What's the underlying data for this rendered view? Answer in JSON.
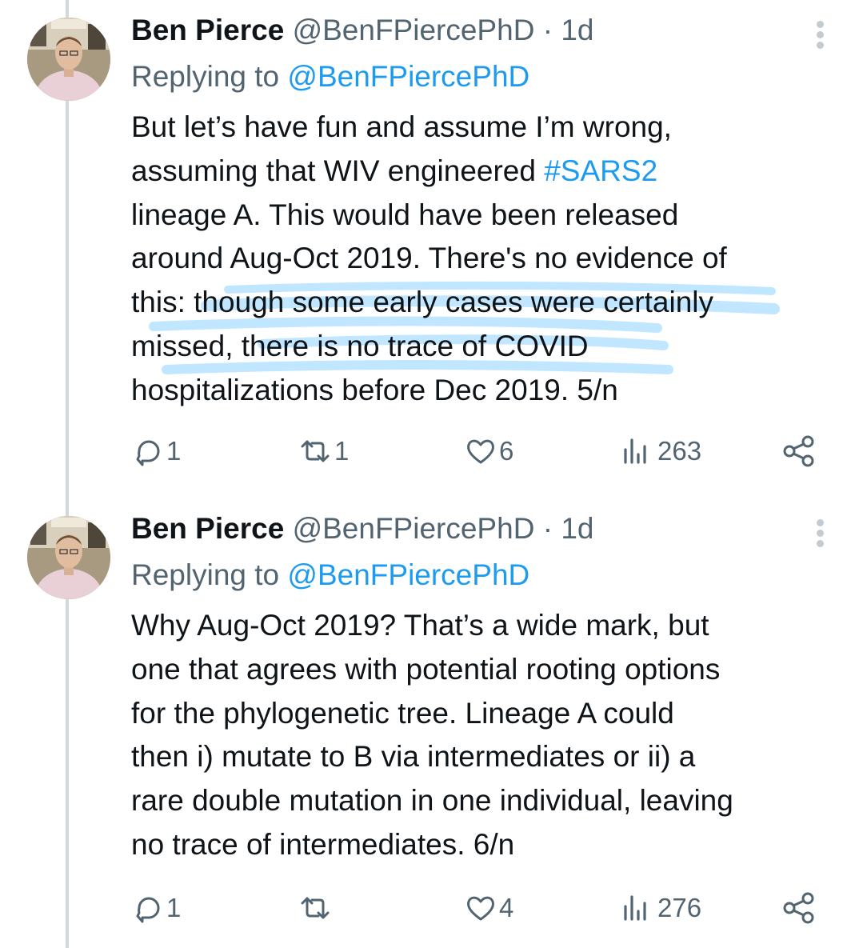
{
  "tweets": [
    {
      "name": "Ben Pierce",
      "handle": "@BenFPiercePhD",
      "dot": "·",
      "time": "1d",
      "replying_prefix": "Replying to",
      "replying_handle": "@BenFPiercePhD",
      "lines": [
        {
          "before": "But let’s have fun and assume I’m wrong,",
          "hashtag": "",
          "after": ""
        },
        {
          "before": "assuming that WIV engineered ",
          "hashtag": "#SARS2",
          "after": ""
        },
        {
          "before": "lineage A. This would have been released",
          "hashtag": "",
          "after": ""
        },
        {
          "before": "around Aug-Oct 2019. There's no evidence of",
          "hashtag": "",
          "after": ""
        },
        {
          "before": "this: though some early cases were certainly",
          "hashtag": "",
          "after": ""
        },
        {
          "before": "missed, there is no trace of COVID",
          "hashtag": "",
          "after": ""
        },
        {
          "before": "hospitalizations before Dec 2019. 5/n",
          "hashtag": "",
          "after": ""
        }
      ],
      "replies": "1",
      "reposts": "1",
      "likes": "6",
      "views": "263",
      "highlight_color": "#8fd3ff"
    },
    {
      "name": "Ben Pierce",
      "handle": "@BenFPiercePhD",
      "dot": "·",
      "time": "1d",
      "replying_prefix": "Replying to",
      "replying_handle": "@BenFPiercePhD",
      "lines": [
        {
          "before": "Why Aug-Oct 2019? That’s a wide mark, but",
          "hashtag": "",
          "after": ""
        },
        {
          "before": "one that agrees with potential rooting options",
          "hashtag": "",
          "after": ""
        },
        {
          "before": "for the phylogenetic tree. Lineage A could",
          "hashtag": "",
          "after": ""
        },
        {
          "before": "then i) mutate to B via intermediates or ii) a",
          "hashtag": "",
          "after": ""
        },
        {
          "before": "rare double mutation in one individual, leaving",
          "hashtag": "",
          "after": ""
        },
        {
          "before": "no trace of intermediates. 6/n",
          "hashtag": "",
          "after": ""
        }
      ],
      "replies": "1",
      "reposts": "",
      "likes": "4",
      "views": "276"
    }
  ],
  "colors": {
    "text": "#0f1419",
    "secondary": "#536471",
    "link": "#1d9bf0",
    "thread_line": "#cfd9de",
    "background": "#ffffff"
  },
  "icons": [
    "reply-icon",
    "repost-icon",
    "like-icon",
    "views-icon",
    "share-icon",
    "more-icon"
  ]
}
